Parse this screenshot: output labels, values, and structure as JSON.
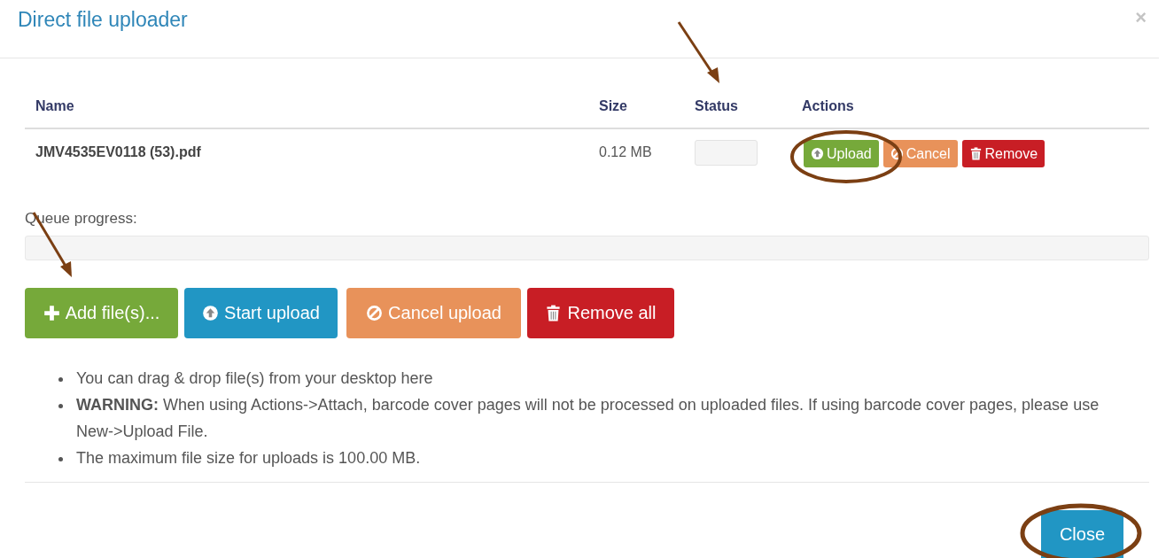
{
  "dialog": {
    "title": "Direct file uploader",
    "close_glyph": "×"
  },
  "table": {
    "columns": [
      "Name",
      "Size",
      "Status",
      "Actions"
    ],
    "rows": [
      {
        "name": "JMV4535EV0118 (53).pdf",
        "size": "0.12 MB",
        "actions": [
          {
            "kind": "upload",
            "label": "Upload"
          },
          {
            "kind": "cancel",
            "label": "Cancel"
          },
          {
            "kind": "remove",
            "label": "Remove"
          }
        ]
      }
    ]
  },
  "queue": {
    "label": "Queue progress:",
    "level": 0
  },
  "buttons": [
    {
      "kind": "add",
      "label": "Add file(s)..."
    },
    {
      "kind": "upload",
      "label": "Start upload"
    },
    {
      "kind": "cancel",
      "label": "Cancel upload"
    },
    {
      "kind": "remove",
      "label": "Remove all"
    }
  ],
  "notes": [
    "You can drag & drop file(s) from your desktop here",
    "**WARNING:** When using Actions->Attach, barcode cover pages will not be processed on uploaded files. If using barcode cover pages, please use New->Upload File.",
    "The maximum file size for uploads is 100.00 MB."
  ],
  "footer": {
    "close_label": "Close"
  }
}
